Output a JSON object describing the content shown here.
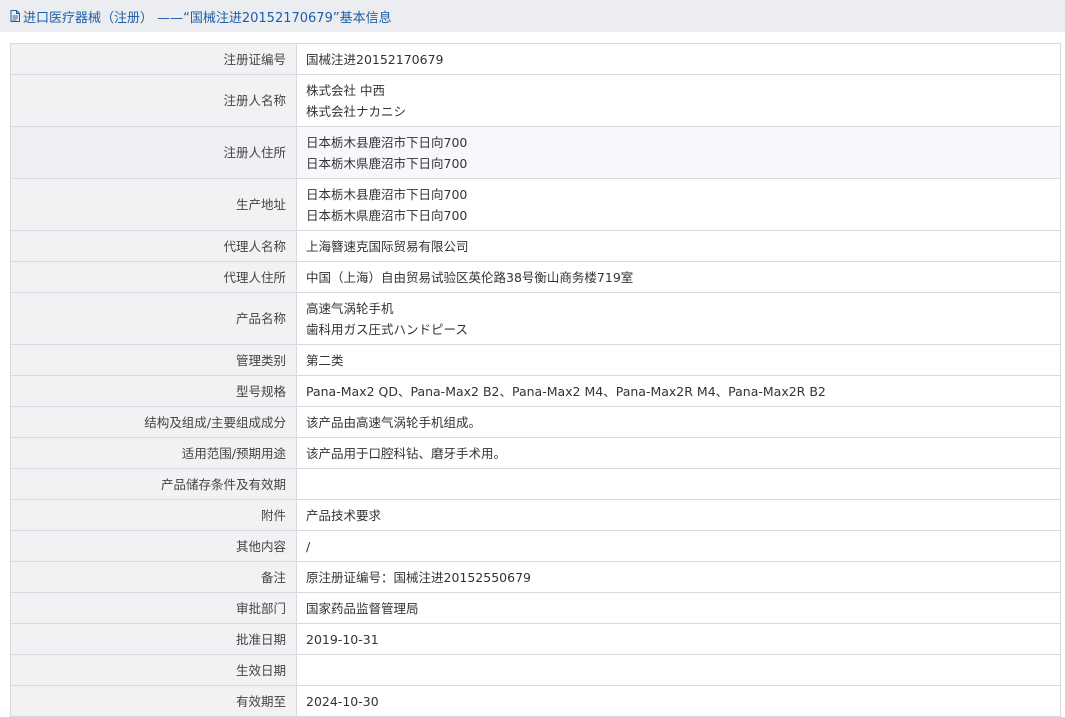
{
  "header": {
    "icon": "document-icon",
    "title": "进口医疗器械（注册） ——“国械注进20152170679”基本信息"
  },
  "colors": {
    "header_bg": "#ebedf0",
    "title_text": "#1d5fa8",
    "border": "#d7d9de",
    "label_bg": "#f2f2f4"
  },
  "rows": [
    {
      "label": "注册证编号",
      "values": [
        "国械注进20152170679"
      ]
    },
    {
      "label": "注册人名称",
      "values": [
        "株式会社 中西",
        "株式会社ナカニシ"
      ]
    },
    {
      "label": "注册人住所",
      "values": [
        "日本栃木县鹿沼市下日向700",
        "日本栃木県鹿沼市下日向700"
      ]
    },
    {
      "label": "生产地址",
      "values": [
        "日本栃木县鹿沼市下日向700",
        "日本栃木県鹿沼市下日向700"
      ]
    },
    {
      "label": "代理人名称",
      "values": [
        "上海簪速克国际贸易有限公司"
      ]
    },
    {
      "label": "代理人住所",
      "values": [
        "中国（上海）自由贸易试验区英伦路38号衡山商务楼719室"
      ]
    },
    {
      "label": "产品名称",
      "values": [
        "高速气涡轮手机",
        "歯科用ガス圧式ハンドピース"
      ]
    },
    {
      "label": "管理类别",
      "values": [
        "第二类"
      ]
    },
    {
      "label": "型号规格",
      "values": [
        "Pana-Max2 QD、Pana-Max2 B2、Pana-Max2 M4、Pana-Max2R M4、Pana-Max2R B2"
      ]
    },
    {
      "label": "结构及组成/主要组成成分",
      "values": [
        "该产品由高速气涡轮手机组成。"
      ]
    },
    {
      "label": "适用范围/预期用途",
      "values": [
        "该产品用于口腔科钻、磨牙手术用。"
      ]
    },
    {
      "label": "产品储存条件及有效期",
      "values": [
        ""
      ]
    },
    {
      "label": "附件",
      "values": [
        "产品技术要求"
      ]
    },
    {
      "label": "其他内容",
      "values": [
        "/"
      ]
    },
    {
      "label": "备注",
      "values": [
        "原注册证编号：国械注进20152550679"
      ]
    },
    {
      "label": "审批部门",
      "values": [
        "国家药品监督管理局"
      ]
    },
    {
      "label": "批准日期",
      "values": [
        "2019-10-31"
      ]
    },
    {
      "label": "生效日期",
      "values": [
        ""
      ]
    },
    {
      "label": "有效期至",
      "values": [
        "2024-10-30"
      ]
    }
  ]
}
